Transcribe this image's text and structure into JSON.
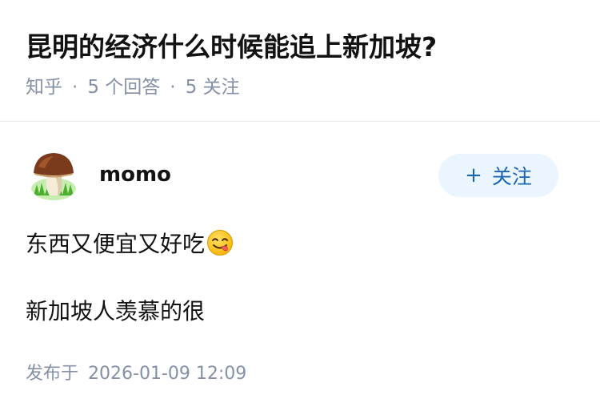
{
  "question": {
    "title": "昆明的经济什么时候能追上新加坡?",
    "source": "知乎",
    "separator": "·",
    "answers_count": "5 个回答",
    "followers_count": "5 关注"
  },
  "author": {
    "name": "momo",
    "avatar_icon": "mushroom-avatar-icon",
    "follow_plus": "+",
    "follow_label": "关注"
  },
  "answer": {
    "paragraph_1": "东西又便宜又好吃",
    "emoji_icon": "yummy-face-emoji-icon",
    "paragraph_2": "新加坡人羡慕的很"
  },
  "footer": {
    "publish_label": "发布于",
    "publish_time": "2026-01-09 12:09"
  },
  "colors": {
    "text_primary": "#121212",
    "text_secondary": "#8590a6",
    "follow_button_bg": "#ebf5ff",
    "follow_button_text": "#1a66b3",
    "divider": "#ebebeb"
  }
}
